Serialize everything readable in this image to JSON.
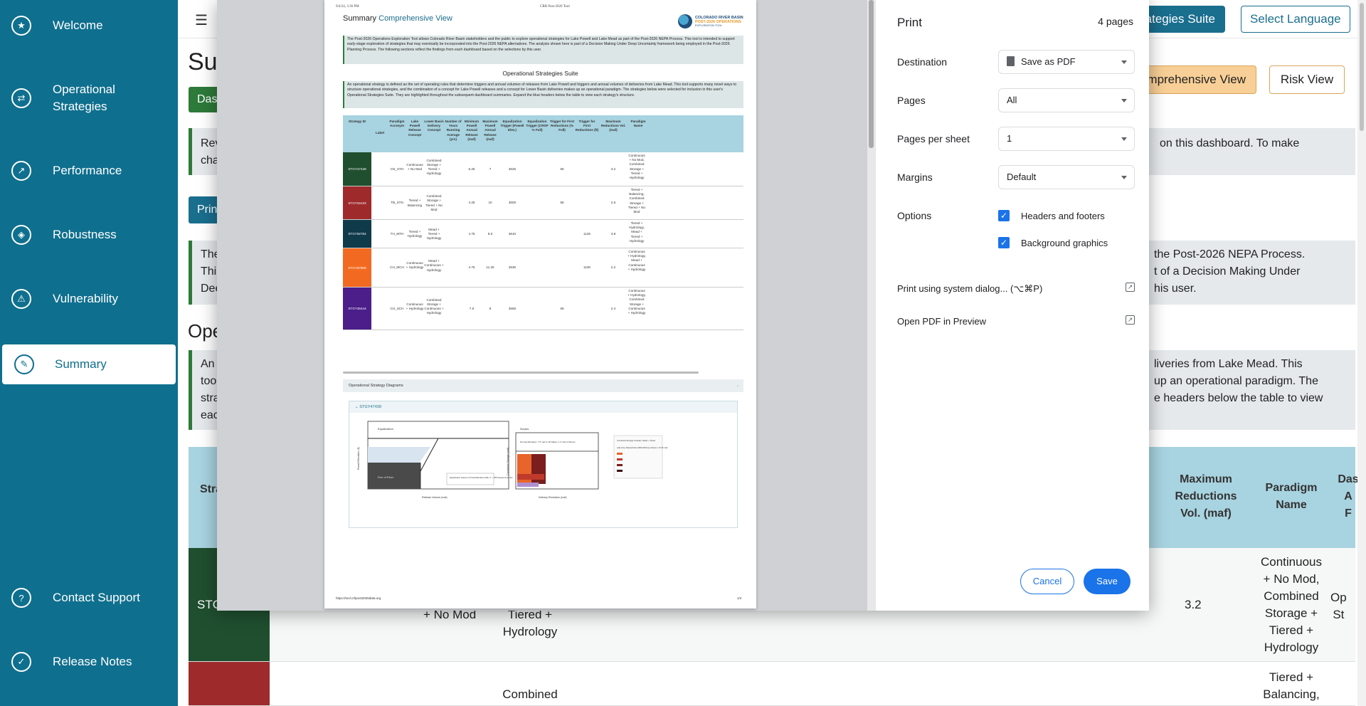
{
  "sidebar": {
    "items": [
      {
        "label": "Welcome",
        "icon": "star-icon"
      },
      {
        "label": "Operational Strategies",
        "icon": "arrows-icon"
      },
      {
        "label": "Performance",
        "icon": "chart-icon"
      },
      {
        "label": "Robustness",
        "icon": "shield-icon"
      },
      {
        "label": "Vulnerability",
        "icon": "warning-icon"
      },
      {
        "label": "Summary",
        "icon": "summary-icon"
      },
      {
        "label": "Contact Support",
        "icon": "support-icon"
      },
      {
        "label": "Release Notes",
        "icon": "notes-icon"
      }
    ],
    "active": "Summary"
  },
  "main": {
    "btn_suite": "rategies Suite",
    "btn_lang": "Select Language",
    "title": "Su",
    "btn_dash": "Das",
    "btn_comp_view": "omprehensive View",
    "btn_risk_view": "Risk View",
    "notice1_left": "Rev\ncha",
    "notice1_right": "on this dashboard. To make",
    "btn_print": "Prin",
    "notice2_left": "The\nThi\nDee",
    "notice2_right": "the Post-2026 NEPA Process.\nt of a Decision Making Under\nhis user.",
    "section_h": "Ope",
    "notice3_left": "An\ntoo\nstra\neac",
    "notice3_right": "liveries from Lake Mead. This\nup an operational paradigm. The\ne headers below the table to view",
    "th_stra": "Stra",
    "th_max": "Maximum\nReductions\nVol. (maf)",
    "th_paradigm": "Paradigm\nName",
    "th_das": "Das\nA\nF",
    "row1": {
      "id": "STG",
      "concept": "+ No Mod",
      "delivery": "Tiered +\nHydrology",
      "maxred": "3.2",
      "paradigm": "Continuous\n+ No Mod,\nCombined\nStorage +\nTiered +\nHydrology",
      "extra": "Op\nSt"
    },
    "row2": {
      "delivery": "Combined",
      "paradigm": "Tiered +\nBalancing,"
    }
  },
  "print_dialog": {
    "title": "Print",
    "pages_count": "4 pages",
    "destination_label": "Destination",
    "destination_value": "Save as PDF",
    "pages_label": "Pages",
    "pages_value": "All",
    "pps_label": "Pages per sheet",
    "pps_value": "1",
    "margins_label": "Margins",
    "margins_value": "Default",
    "options_label": "Options",
    "opt_headers": "Headers and footers",
    "opt_bg": "Background graphics",
    "opt_headers_checked": true,
    "opt_bg_checked": true,
    "system_dialog": "Print using system dialog... (⌥⌘P)",
    "open_pdf": "Open PDF in Preview",
    "cancel": "Cancel",
    "save": "Save"
  },
  "pdf_preview": {
    "header_left": "9/4/24, 3:36 PM",
    "header_center": "CRB Post-2026 Tool",
    "title": "Summary",
    "title_accent": "Comprehensive View",
    "logo_line1": "COLORADO RIVER BASIN",
    "logo_line2": "POST-2026 OPERATIONS",
    "logo_line3": "EXPLORATION TOOL",
    "intro": "The Post-2026 Operations Exploration Tool allows Colorado River Basin stakeholders and the public to explore operational strategies for Lake Powell and Lake Mead as part of the Post-2026 NEPA Process. This tool is intended to support early-stage exploration of strategies that may eventually be incorporated into the Post-2026 NEPA alternatives. The analysis shown here is part of a Decision Making Under Deep Uncertainty framework being employed in the Post-2026 Planning Process. The following sections reflect the findings from each dashboard based on the selections by this user.",
    "subtitle": "Operational Strategies Suite",
    "ops_text": "An operational strategy is defined as the set of operating rules that determine triggers and annual volumes of releases from Lake Powell and triggers and annual volumes of deliveries from Lake Mead. This tool supports many novel ways to structure operational strategies, and the combination of a concept for Lake Powell releases and a concept for Lower Basin deliveries makes up an operational paradigm. The strategies below were selected for inclusion in this user's Operational Strategies Suite. They are highlighted throughout the subsequent dashboard summaries. Expand the blue headers below the table to view each strategy's structure.",
    "table_headers": [
      "Strategy ID",
      "Label",
      "Paradigm Acronym",
      "Lake Powell Release Concept",
      "Lower Basin Delivery Concept",
      "Number of Years Running Average (yrs)",
      "Minimum Powell Annual Release (maf)",
      "Maximum Powell Annual Release (maf)",
      "Equalization Trigger (Powell Elev.)",
      "Equalization Trigger (CRSP % Full)",
      "Trigger for First Reductions (% Full)",
      "Trigger for First Reductions (ft)",
      "Maximum Reductions Vol. (maf)",
      "Paradigm Name"
    ],
    "rows": [
      {
        "id": "STGY47439",
        "color": "#1f4f2f",
        "acr": "CN_STH",
        "rel": "Continuous + No Mod",
        "del": "Combined Storage + Tiered + Hydrology",
        "min": "5.25",
        "max": "7",
        "eq": "3625",
        "tfr": "65",
        "tft": "",
        "red": "3.2",
        "par": "Continuous + No Mod, Combined Storage + Tiered + Hydrology"
      },
      {
        "id": "STGY02433",
        "color": "#9e2a2b",
        "acr": "TB_STN",
        "rel": "Tiered + Balancing",
        "del": "Combined Storage + Tiered + No Mod",
        "min": "4.25",
        "max": "10",
        "eq": "3600",
        "tfr": "55",
        "tft": "",
        "red": "2.6",
        "par": "Tiered + Balancing, Combined Storage + Tiered + No Mod"
      },
      {
        "id": "STGY92784",
        "color": "#0e3a4a",
        "acr": "TH_MTH",
        "rel": "Tiered + Hydrology",
        "del": "Mead + Tiered + Hydrology",
        "min": "4.75",
        "max": "8.5",
        "eq": "3610",
        "tfr": "",
        "tft": "1125",
        "red": "3.8",
        "par": "Tiered + Hydrology, Mead + Tiered + Hydrology"
      },
      {
        "id": "STGY97809",
        "color": "#f26a21",
        "acr": "CH_MCH",
        "rel": "Continuous + Hydrology",
        "del": "Mead + Continuous + Hydrology",
        "min": "4.75",
        "max": "11.25",
        "eq": "3630",
        "tfr": "",
        "tft": "1100",
        "red": "2.2",
        "par": "Continuous + Hydrology, Mead + Continuous + Hydrology"
      },
      {
        "id": "STGY36444",
        "color": "#4b1e8a",
        "acr": "CH_SCH",
        "rel": "Continuous + Hydrology",
        "del": "Combined Storage + Continuous + Hydrology",
        "min": "7.5",
        "max": "8",
        "eq": "3565",
        "tfr": "65",
        "tft": "",
        "red": "2.4",
        "par": "Continuous + Hydrology, Combined Storage + Continuous + Hydrology"
      }
    ],
    "accordion": "Operational Strategy Diagrams",
    "diagram_header": "STGY47439",
    "diagram1": {
      "ylabel": "Powell Elevation (ft)",
      "xlabel": "Release Volume (maf)",
      "label_eq": "Equalization",
      "label_run": "Run of River",
      "note": "Equalization based on Powell Elevation (Min. 0 ∼ 25% Equal Contents)"
    },
    "diagram2": {
      "ylabel": "Combined Storage (maf)",
      "xlabel": "Delivery Reduction (maf)",
      "label_surplus": "Surplus",
      "note": "Normal Allocation: 7.5 maf to LB States, 1.5 maf to Mexico",
      "legend_title": "Combined Storage Includes: Mead + Tiered",
      "legend_sub": "Lake Ferry Natural Flow (1906-2020 Avg Volume = 15.46 maf)"
    },
    "footer_left": "https://tool.crbpost2026data.org",
    "footer_right": "1/4"
  }
}
